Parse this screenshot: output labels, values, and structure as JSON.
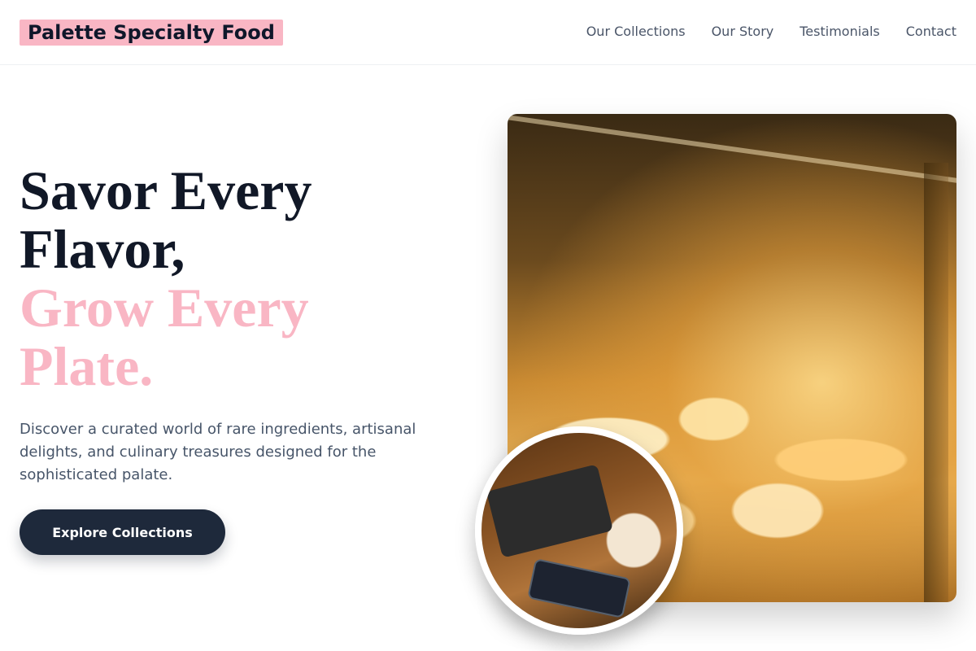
{
  "header": {
    "brand": "Palette Specialty Food",
    "nav": [
      "Our Collections",
      "Our Story",
      "Testimonials",
      "Contact"
    ]
  },
  "hero": {
    "headline_dark": [
      "Savor Every",
      "Flavor,"
    ],
    "headline_accent": [
      "Grow Every",
      "Plate."
    ],
    "description": "Discover a curated world of rare ingredients, artisanal delights, and culinary treasures designed for the sophisticated palate.",
    "cta_label": "Explore Collections"
  },
  "colors": {
    "brand_highlight": "#f9b6c4",
    "accent_text": "#f9b6c4",
    "heading_text": "#111827",
    "cta_background": "#1e293b"
  },
  "images": {
    "main": "cheese-display-case-photo",
    "inset": "breakfast-plate-with-phone-photo"
  }
}
